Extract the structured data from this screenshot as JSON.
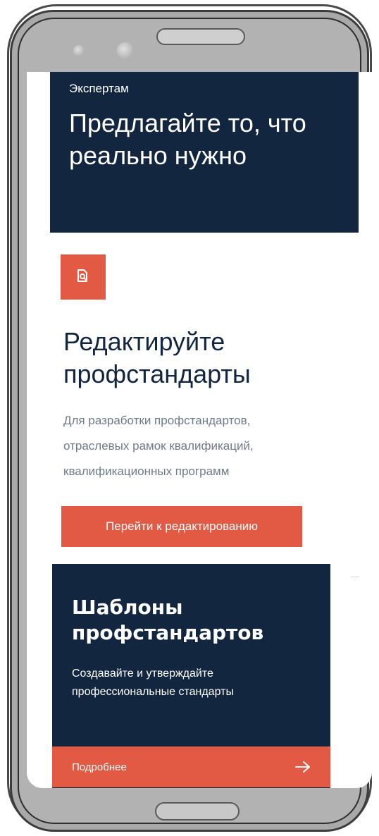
{
  "hero": {
    "kicker": "Экспертам",
    "title": "Предлагайте то, что реально нужно"
  },
  "feature": {
    "icon": "document-search-icon",
    "title": "Редактируйте профстандарты",
    "description_lines": [
      "Для разработки профстандартов,",
      "отраслевых рамок квалификаций,",
      "квалификационных программ"
    ],
    "button_label": "Перейти к редактированию"
  },
  "card": {
    "title": "Шаблоны профстандартов",
    "description": "Создавайте и утверждайте профессиональные стандарты",
    "footer_label": "Подробнее",
    "footer_icon": "arrow-right-icon"
  },
  "colors": {
    "navy": "#13263f",
    "accent": "#e25a44",
    "muted_text": "#6f7a88"
  }
}
